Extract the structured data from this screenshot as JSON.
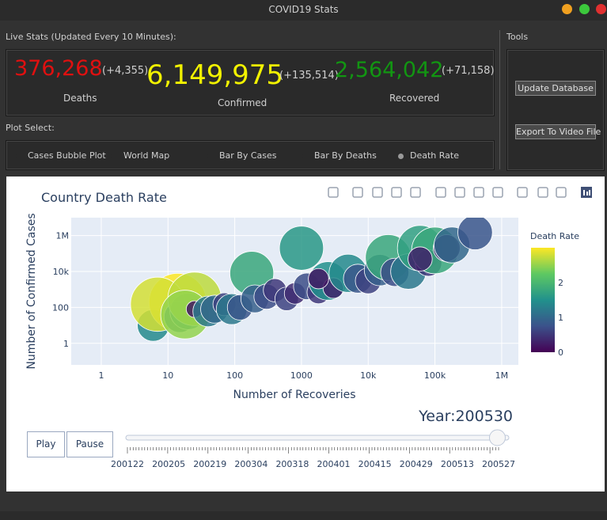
{
  "window": {
    "title": "COVID19 Stats"
  },
  "live_stats": {
    "label": "Live Stats (Updated Every 10 Minutes):",
    "deaths": {
      "value": "376,268",
      "delta": "(+4,355)",
      "caption": "Deaths",
      "color": "#e01010"
    },
    "confirmed": {
      "value": "6,149,975",
      "delta": "(+135,514)",
      "caption": "Confirmed",
      "color": "#f2f200"
    },
    "recovered": {
      "value": "2,564,042",
      "delta": "(+71,158)",
      "caption": "Recovered",
      "color": "#129612"
    }
  },
  "tools": {
    "label": "Tools",
    "update_button": "Update Database",
    "export_button": "Export To Video File"
  },
  "plot_select": {
    "label": "Plot Select:",
    "options": [
      "Cases Bubble Plot",
      "World Map",
      "Bar By Cases",
      "Bar By Deaths",
      "Death Rate"
    ],
    "selected": "Death Rate"
  },
  "plot": {
    "play_label": "Play",
    "pause_label": "Pause",
    "year_label": "Year:200530",
    "slider_ticks": [
      "200122",
      "200205",
      "200219",
      "200304",
      "200318",
      "200401",
      "200415",
      "200429",
      "200513",
      "200527"
    ],
    "slider_value": 0.97
  },
  "modebar_icons": [
    "camera-icon",
    "zoom-icon",
    "pan-icon",
    "box-select-icon",
    "lasso-icon",
    "zoom-in-icon",
    "zoom-out-icon",
    "autoscale-icon",
    "home-icon",
    "spike-icon",
    "hover-closest-icon",
    "hover-compare-icon",
    "plotly-logo-icon"
  ],
  "chart_data": {
    "type": "scatter",
    "title": "Country Death Rate",
    "xlabel": "Number of Recoveries",
    "ylabel": "Number of Confirmed Cases",
    "x_scale": "log",
    "y_scale": "log",
    "x_ticks": [
      "1",
      "10",
      "100",
      "1000",
      "10k",
      "100k",
      "1M"
    ],
    "y_ticks": [
      "1",
      "100",
      "10k",
      "1M"
    ],
    "colorbar": {
      "title": "Death Rate",
      "ticks": [
        "0",
        "1",
        "2"
      ],
      "range": [
        0,
        3
      ]
    },
    "grid": true,
    "points": [
      {
        "x": 6,
        "y": 10,
        "rate": 1.4
      },
      {
        "x": 14,
        "y": 200,
        "rate": 3.0
      },
      {
        "x": 7,
        "y": 150,
        "rate": 2.8
      },
      {
        "x": 15,
        "y": 30,
        "rate": 1.3
      },
      {
        "x": 20,
        "y": 60,
        "rate": 1.6
      },
      {
        "x": 25,
        "y": 300,
        "rate": 2.7
      },
      {
        "x": 18,
        "y": 40,
        "rate": 2.5
      },
      {
        "x": 25,
        "y": 80,
        "rate": 0.2
      },
      {
        "x": 40,
        "y": 60,
        "rate": 1.2
      },
      {
        "x": 50,
        "y": 80,
        "rate": 1.0
      },
      {
        "x": 70,
        "y": 150,
        "rate": 0.6
      },
      {
        "x": 90,
        "y": 80,
        "rate": 1.2
      },
      {
        "x": 120,
        "y": 100,
        "rate": 0.8
      },
      {
        "x": 180,
        "y": 8000,
        "rate": 1.8
      },
      {
        "x": 200,
        "y": 300,
        "rate": 0.9
      },
      {
        "x": 300,
        "y": 400,
        "rate": 0.7
      },
      {
        "x": 400,
        "y": 900,
        "rate": 0.5
      },
      {
        "x": 600,
        "y": 300,
        "rate": 0.6
      },
      {
        "x": 800,
        "y": 600,
        "rate": 0.4
      },
      {
        "x": 1000,
        "y": 200000,
        "rate": 1.6
      },
      {
        "x": 1200,
        "y": 1500,
        "rate": 0.7
      },
      {
        "x": 1800,
        "y": 700,
        "rate": 0.5
      },
      {
        "x": 2500,
        "y": 3000,
        "rate": 1.5
      },
      {
        "x": 3000,
        "y": 1200,
        "rate": 0.3
      },
      {
        "x": 5000,
        "y": 8000,
        "rate": 1.4
      },
      {
        "x": 7000,
        "y": 4000,
        "rate": 0.8
      },
      {
        "x": 10000,
        "y": 3000,
        "rate": 0.6
      },
      {
        "x": 15000,
        "y": 12000,
        "rate": 0.9
      },
      {
        "x": 20000,
        "y": 60000,
        "rate": 1.8
      },
      {
        "x": 25000,
        "y": 9000,
        "rate": 0.7
      },
      {
        "x": 40000,
        "y": 10000,
        "rate": 1.2
      },
      {
        "x": 60000,
        "y": 200000,
        "rate": 1.7
      },
      {
        "x": 80000,
        "y": 30000,
        "rate": 0.5
      },
      {
        "x": 100000,
        "y": 150000,
        "rate": 1.8
      },
      {
        "x": 150000,
        "y": 200000,
        "rate": 0.4
      },
      {
        "x": 180000,
        "y": 300000,
        "rate": 1.0
      },
      {
        "x": 400000,
        "y": 1500000,
        "rate": 0.8
      },
      {
        "x": 1800,
        "y": 4000,
        "rate": 0.2
      },
      {
        "x": 60000,
        "y": 50000,
        "rate": 0.3
      }
    ]
  }
}
